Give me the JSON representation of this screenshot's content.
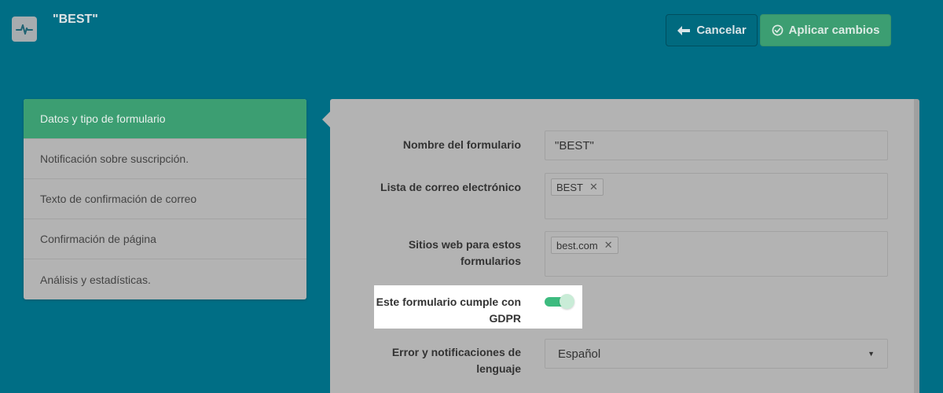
{
  "header": {
    "title": "\"BEST\"",
    "cancel_label": "Cancelar",
    "apply_label": "Aplicar cambios",
    "logo_icon": "pulse-icon"
  },
  "sidebar": {
    "items": [
      {
        "label": "Datos y tipo de formulario",
        "active": true
      },
      {
        "label": "Notificación sobre suscripción."
      },
      {
        "label": "Texto de confirmación de correo"
      },
      {
        "label": "Confirmación de página"
      },
      {
        "label": "Análisis y estadísticas."
      }
    ]
  },
  "form": {
    "name_label": "Nombre del formulario",
    "name_value": "\"BEST\"",
    "email_list_label": "Lista de correo electrónico",
    "email_list_tags": [
      "BEST"
    ],
    "websites_label_line1": "Sitios web para estos",
    "websites_label_line2": "formularios",
    "websites_tags": [
      "best.com"
    ],
    "gdpr_label_line1": "Este formulario cumple con",
    "gdpr_label_line2": "GDPR",
    "gdpr_enabled": true,
    "language_label_line1": "Error y notificaciones de",
    "language_label_line2": "lenguaje",
    "language_value": "Español"
  },
  "colors": {
    "background": "#006e85",
    "accent_green": "#3c9e72",
    "toggle_on": "#3dbb7f"
  }
}
